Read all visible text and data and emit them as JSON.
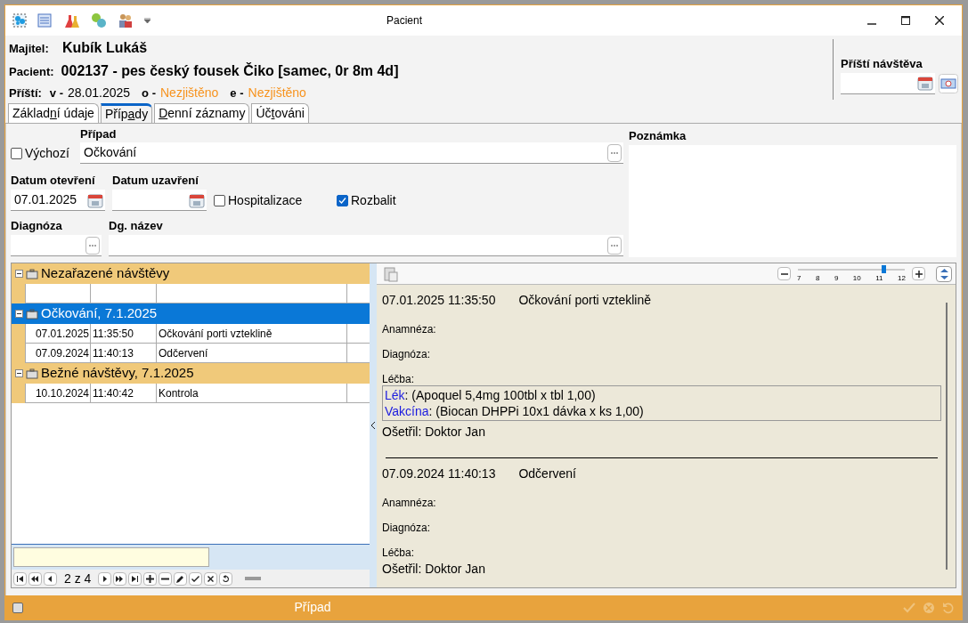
{
  "window": {
    "title": "Pacient"
  },
  "header": {
    "owner_label": "Majitel:",
    "owner": "Kubík Lukáš",
    "patient_label": "Pacient:",
    "patient": "002137 - pes český fousek Čiko [samec, 0r  8m  4d]",
    "next_label": "Příští:",
    "next_items": [
      {
        "label": "v -",
        "value": "28.01.2025",
        "kind": "date"
      },
      {
        "label": "o -",
        "value": "Nezjištěno",
        "kind": "unknown"
      },
      {
        "label": "e -",
        "value": "Nezjištěno",
        "kind": "unknown"
      }
    ],
    "next_visit_label": "Příští návštěva"
  },
  "tabs": [
    {
      "before": "Základ",
      "key": "n",
      "after": "í údaje",
      "selected": false
    },
    {
      "before": "Příp",
      "key": "a",
      "after": "dy",
      "selected": true
    },
    {
      "key": "D",
      "after": "enní záznamy",
      "selected": false
    },
    {
      "before": "Úč",
      "key": "t",
      "after": "ováni",
      "selected": false
    }
  ],
  "form": {
    "default_checkbox": {
      "label": "Výchozí",
      "checked": false
    },
    "case": {
      "label": "Případ",
      "value": "Očkování"
    },
    "note_label": "Poznámka",
    "opened": {
      "label": "Datum otevření",
      "value": "07.01.2025"
    },
    "closed": {
      "label": "Datum uzavření"
    },
    "hospitalization": {
      "label": "Hospitalizace",
      "checked": false
    },
    "expand": {
      "label": "Rozbalit",
      "checked": true
    },
    "diagnosis": {
      "label": "Diagnóza"
    },
    "dg_name": {
      "label": "Dg. název"
    }
  },
  "tree": [
    {
      "title": "Nezařazené návštěvy",
      "expanded": true,
      "selected": false,
      "rows": [
        {
          "kind": "blank"
        }
      ]
    },
    {
      "title": "Očkování, 7.1.2025",
      "expanded": true,
      "selected": true,
      "rows": [
        {
          "kind": "visit",
          "date": "07.01.2025",
          "time": "11:35:50",
          "title": "Očkování porti vzteklině"
        },
        {
          "kind": "visit",
          "date": "07.09.2024",
          "time": "11:40:13",
          "title": "Odčervení"
        }
      ]
    },
    {
      "title": "Bežné návštěvy, 7.1.2025",
      "expanded": true,
      "selected": false,
      "rows": [
        {
          "kind": "visit",
          "date": "10.10.2024",
          "time": "11:40:42",
          "title": "Kontrola"
        }
      ]
    }
  ],
  "pager": {
    "position": "2 z 4"
  },
  "detail": {
    "zoom": {
      "ticks": [
        "7",
        "8",
        "9",
        "10",
        "11",
        "12"
      ],
      "level": 0.8
    },
    "entries": [
      {
        "datetime": "07.01.2025 11:35:50",
        "title": "Očkování porti vzteklině",
        "labels": [
          "Anamnéza:",
          "Diagnóza:",
          "Léčba:"
        ],
        "treatment": [
          {
            "label": "Lék",
            "text": ": (Apoquel 5,4mg 100tbl x tbl 1,00)"
          },
          {
            "label": "Vakcína",
            "text": ": (Biocan DHPPi 10x1 dávka x ks 1,00)"
          }
        ],
        "doctor": "Ošetřil: Doktor Jan"
      },
      {
        "datetime": "07.09.2024 11:40:13",
        "title": "Odčervení",
        "labels": [
          "Anamnéza:",
          "Diagnóza:",
          "Léčba:"
        ],
        "doctor": "Ošetřil: Doktor Jan"
      }
    ]
  },
  "status_bar": {
    "title": "Případ"
  }
}
